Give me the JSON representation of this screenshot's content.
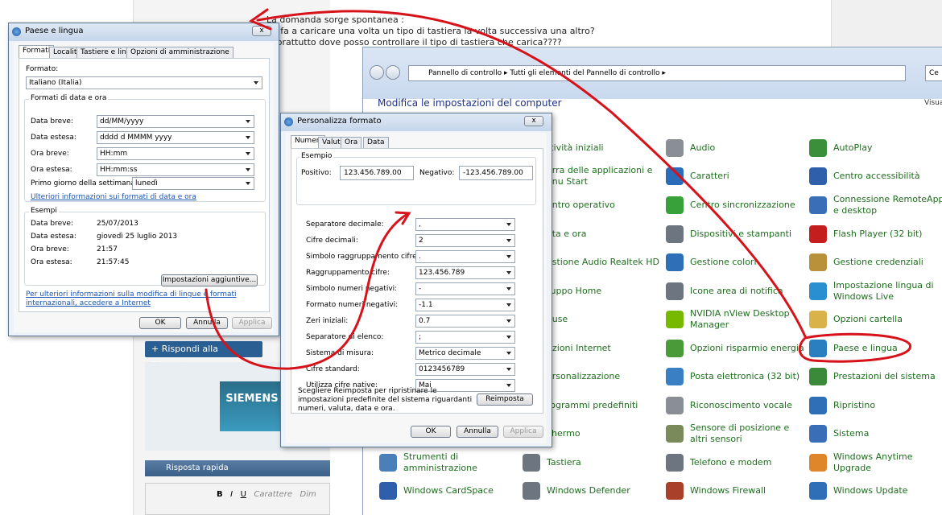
{
  "forum": {
    "question_lines": [
      "La domanda sorge spontanea :",
      "he fa a caricare una volta un tipo di tastiera la volta successiva una altro?",
      "soprattutto dove posso controllare il tipo di tastiera che carica????"
    ],
    "reply_button": "+ Rispondi alla Discussione",
    "siemens_logo": "SIEMENS",
    "quick_reply": "Risposta rapida",
    "editor_font": "Carattere",
    "editor_bold": "B",
    "editor_italic": "I",
    "editor_underline": "U",
    "editor_dim": "Dim"
  },
  "control_panel": {
    "breadcrumb": [
      "Pannello di controllo",
      "Tutti gli elementi del Pannello di controllo"
    ],
    "search_placeholder": "Ce",
    "title": "Modifica le impostazioni del computer",
    "view_label": "Visual",
    "items": [
      {
        "label": "ttività iniziali",
        "icon": "start-icon",
        "color": "#3c7fc4"
      },
      {
        "label": "Audio",
        "icon": "audio-icon",
        "color": "#8a8f97"
      },
      {
        "label": "AutoPlay",
        "icon": "autoplay-icon",
        "color": "#3b8f3b"
      },
      {
        "label": "arra delle applicazioni e enu Start",
        "icon": "taskbar-icon",
        "color": "#3c7fc4"
      },
      {
        "label": "Caratteri",
        "icon": "fonts-icon",
        "color": "#2b6cb8"
      },
      {
        "label": "Centro accessibilità",
        "icon": "accessibility-icon",
        "color": "#2f5faa"
      },
      {
        "label": "entro operativo",
        "icon": "action-center-icon",
        "color": "#3c7fc4"
      },
      {
        "label": "Centro sincronizzazione",
        "icon": "sync-icon",
        "color": "#39a13a"
      },
      {
        "label": "Connessione RemoteApp e desktop",
        "icon": "remoteapp-icon",
        "color": "#3a6fb8"
      },
      {
        "label": "ata e ora",
        "icon": "clock-icon",
        "color": "#3c7fc4"
      },
      {
        "label": "Dispositivi e stampanti",
        "icon": "printer-icon",
        "color": "#6d7580"
      },
      {
        "label": "Flash Player (32 bit)",
        "icon": "flash-icon",
        "color": "#c41e1e"
      },
      {
        "label": "estione Audio Realtek HD",
        "icon": "realtek-icon",
        "color": "#3c7fc4"
      },
      {
        "label": "Gestione colori",
        "icon": "color-icon",
        "color": "#2f6fb8"
      },
      {
        "label": "Gestione credenziali",
        "icon": "credentials-icon",
        "color": "#b8913a"
      },
      {
        "label": "ruppo Home",
        "icon": "homegroup-icon",
        "color": "#3c7fc4"
      },
      {
        "label": "Icone area di notifica",
        "icon": "notification-icon",
        "color": "#6d7580"
      },
      {
        "label": "Impostazione lingua di Windows Live",
        "icon": "live-language-icon",
        "color": "#2a8fd0"
      },
      {
        "label": "ouse",
        "icon": "mouse-icon",
        "color": "#3c7fc4"
      },
      {
        "label": "NVIDIA nView Desktop Manager",
        "icon": "nvidia-icon",
        "color": "#76b900"
      },
      {
        "label": "Opzioni cartella",
        "icon": "folder-icon",
        "color": "#d9b24a"
      },
      {
        "label": "pzioni Internet",
        "icon": "internet-icon",
        "color": "#3c7fc4"
      },
      {
        "label": "Opzioni risparmio energia",
        "icon": "power-icon",
        "color": "#4a9a3a"
      },
      {
        "label": "Paese e lingua",
        "icon": "region-icon",
        "color": "#2a7fc0"
      },
      {
        "label": "ersonalizzazione",
        "icon": "personalize-icon",
        "color": "#3c7fc4"
      },
      {
        "label": "Posta elettronica (32 bit)",
        "icon": "mail-icon",
        "color": "#3a7fc4"
      },
      {
        "label": "Prestazioni del sistema",
        "icon": "performance-icon",
        "color": "#3a8a3a"
      },
      {
        "label": "rogrammi predefiniti",
        "icon": "default-programs-icon",
        "color": "#3c7fc4"
      },
      {
        "label": "Riconoscimento vocale",
        "icon": "microphone-icon",
        "color": "#8a8f97"
      },
      {
        "label": "Ripristino",
        "icon": "restore-icon",
        "color": "#2f6fb8"
      },
      {
        "label": "chermo",
        "icon": "display-icon",
        "color": "#3c7fc4"
      },
      {
        "label": "Sensore di posizione e altri sensori",
        "icon": "sensor-icon",
        "color": "#7a8a5a"
      },
      {
        "label": "Sistema",
        "icon": "system-icon",
        "color": "#3a6fb8"
      },
      {
        "label": "Strumenti di amministrazione",
        "icon": "admin-tools-icon",
        "color": "#4a7fb8"
      },
      {
        "label": "Tastiera",
        "icon": "keyboard-icon",
        "color": "#6d7580"
      },
      {
        "label": "Telefono e modem",
        "icon": "phone-icon",
        "color": "#6d7580"
      },
      {
        "label": "Windows Anytime Upgrade",
        "icon": "windows-logo-icon",
        "color": "#e0862a"
      },
      {
        "label": "Windows CardSpace",
        "icon": "cardspace-icon",
        "color": "#2f5faa"
      },
      {
        "label": "Windows Defender",
        "icon": "defender-icon",
        "color": "#6d7580"
      },
      {
        "label": "Windows Firewall",
        "icon": "firewall-icon",
        "color": "#a8402a"
      },
      {
        "label": "Windows Update",
        "icon": "update-icon",
        "color": "#2f6fb8"
      }
    ]
  },
  "region_dialog": {
    "title": "Paese e lingua",
    "close": "x",
    "tabs": [
      "Formati",
      "Località",
      "Tastiere e lingue",
      "Opzioni di amministrazione"
    ],
    "format_label": "Formato:",
    "format_value": "Italiano (Italia)",
    "date_group": "Formati di data e ora",
    "rows": [
      {
        "label": "Data breve:",
        "value": "dd/MM/yyyy"
      },
      {
        "label": "Data estesa:",
        "value": "dddd d MMMM yyyy"
      },
      {
        "label": "Ora breve:",
        "value": "HH:mm"
      },
      {
        "label": "Ora estesa:",
        "value": "HH:mm:ss"
      }
    ],
    "first_day_label": "Primo giorno della settimana:",
    "first_day_value": "lunedì",
    "more_info_link": "Ulteriori informazioni sui formati di data e ora",
    "examples_group": "Esempi",
    "examples": [
      {
        "label": "Data breve:",
        "value": "25/07/2013"
      },
      {
        "label": "Data estesa:",
        "value": "giovedì 25 luglio 2013"
      },
      {
        "label": "Ora breve:",
        "value": "21:57"
      },
      {
        "label": "Ora estesa:",
        "value": "21:57:45"
      }
    ],
    "additional_button": "Impostazioni aggiuntive...",
    "bottom_link": "Per ulteriori informazioni sulla modifica di lingue e formati internazionali, accedere a Internet",
    "ok": "OK",
    "cancel": "Annulla",
    "apply": "Applica"
  },
  "format_dialog": {
    "title": "Personalizza formato",
    "close": "x",
    "tabs": [
      "Numeri",
      "Valuta",
      "Ora",
      "Data"
    ],
    "example_group": "Esempio",
    "positive_label": "Positivo:",
    "positive_value": "123.456.789.00",
    "negative_label": "Negativo:",
    "negative_value": "-123.456.789.00",
    "rows": [
      {
        "label": "Separatore decimale:",
        "value": ","
      },
      {
        "label": "Cifre decimali:",
        "value": "2"
      },
      {
        "label": "Simbolo raggruppamento cifre:",
        "value": "."
      },
      {
        "label": "Raggruppamento cifre:",
        "value": "123.456.789"
      },
      {
        "label": "Simbolo numeri negativi:",
        "value": "-"
      },
      {
        "label": "Formato numeri negativi:",
        "value": "-1.1"
      },
      {
        "label": "Zeri iniziali:",
        "value": "0.7"
      },
      {
        "label": "Separatore di elenco:",
        "value": ";"
      },
      {
        "label": "Sistema di misura:",
        "value": "Metrico decimale"
      },
      {
        "label": "Cifre standard:",
        "value": "0123456789"
      },
      {
        "label": "Utilizza cifre native:",
        "value": "Mai"
      }
    ],
    "reset_text": "Scegliere Reimposta per ripristinare le impostazioni predefinite del sistema riguardanti numeri, valuta, data e ora.",
    "reset_button": "Reimposta",
    "ok": "OK",
    "cancel": "Annulla",
    "apply": "Applica"
  },
  "annotation_color": "#d6131a"
}
